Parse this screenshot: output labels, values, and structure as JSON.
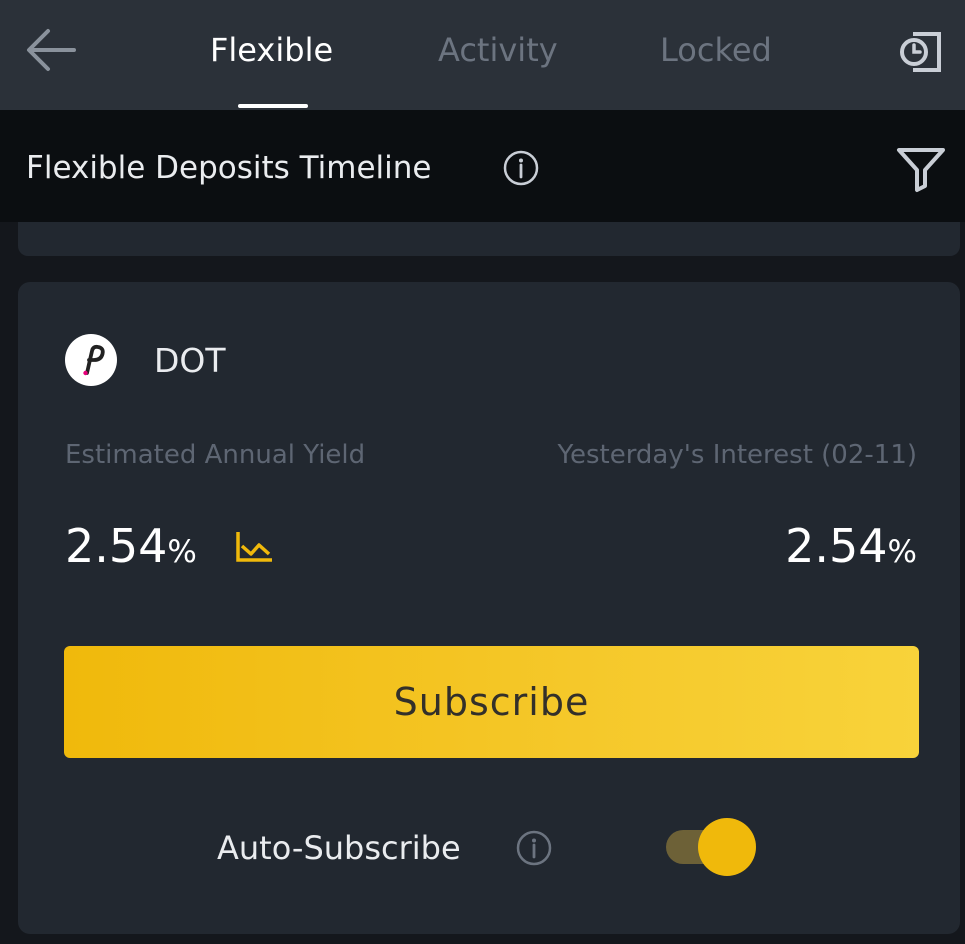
{
  "nav": {
    "back_icon": "arrow-left-icon",
    "tabs": [
      {
        "label": "Flexible",
        "active": true
      },
      {
        "label": "Activity",
        "active": false
      },
      {
        "label": "Locked",
        "active": false
      }
    ],
    "history_icon": "history-icon"
  },
  "timeline": {
    "title": "Flexible Deposits Timeline",
    "info_icon": "info-icon",
    "filter_icon": "filter-icon"
  },
  "product": {
    "coin": "DOT",
    "coin_icon": "polkadot-logo-icon",
    "left_label": "Estimated Annual Yield",
    "right_label": "Yesterday's Interest (02-11)",
    "annual_yield_value": "2.54",
    "annual_yield_unit": "%",
    "interest_value": "2.54",
    "interest_unit": "%",
    "chart_icon": "line-chart-icon",
    "subscribe_label": "Subscribe",
    "auto_subscribe_label": "Auto-Subscribe",
    "auto_subscribe_enabled": true
  },
  "colors": {
    "accent": "#f0b90b",
    "nav_bg": "#2b3139",
    "page_bg": "#14171c",
    "card_bg": "#222830",
    "muted_text": "#5e6673"
  }
}
